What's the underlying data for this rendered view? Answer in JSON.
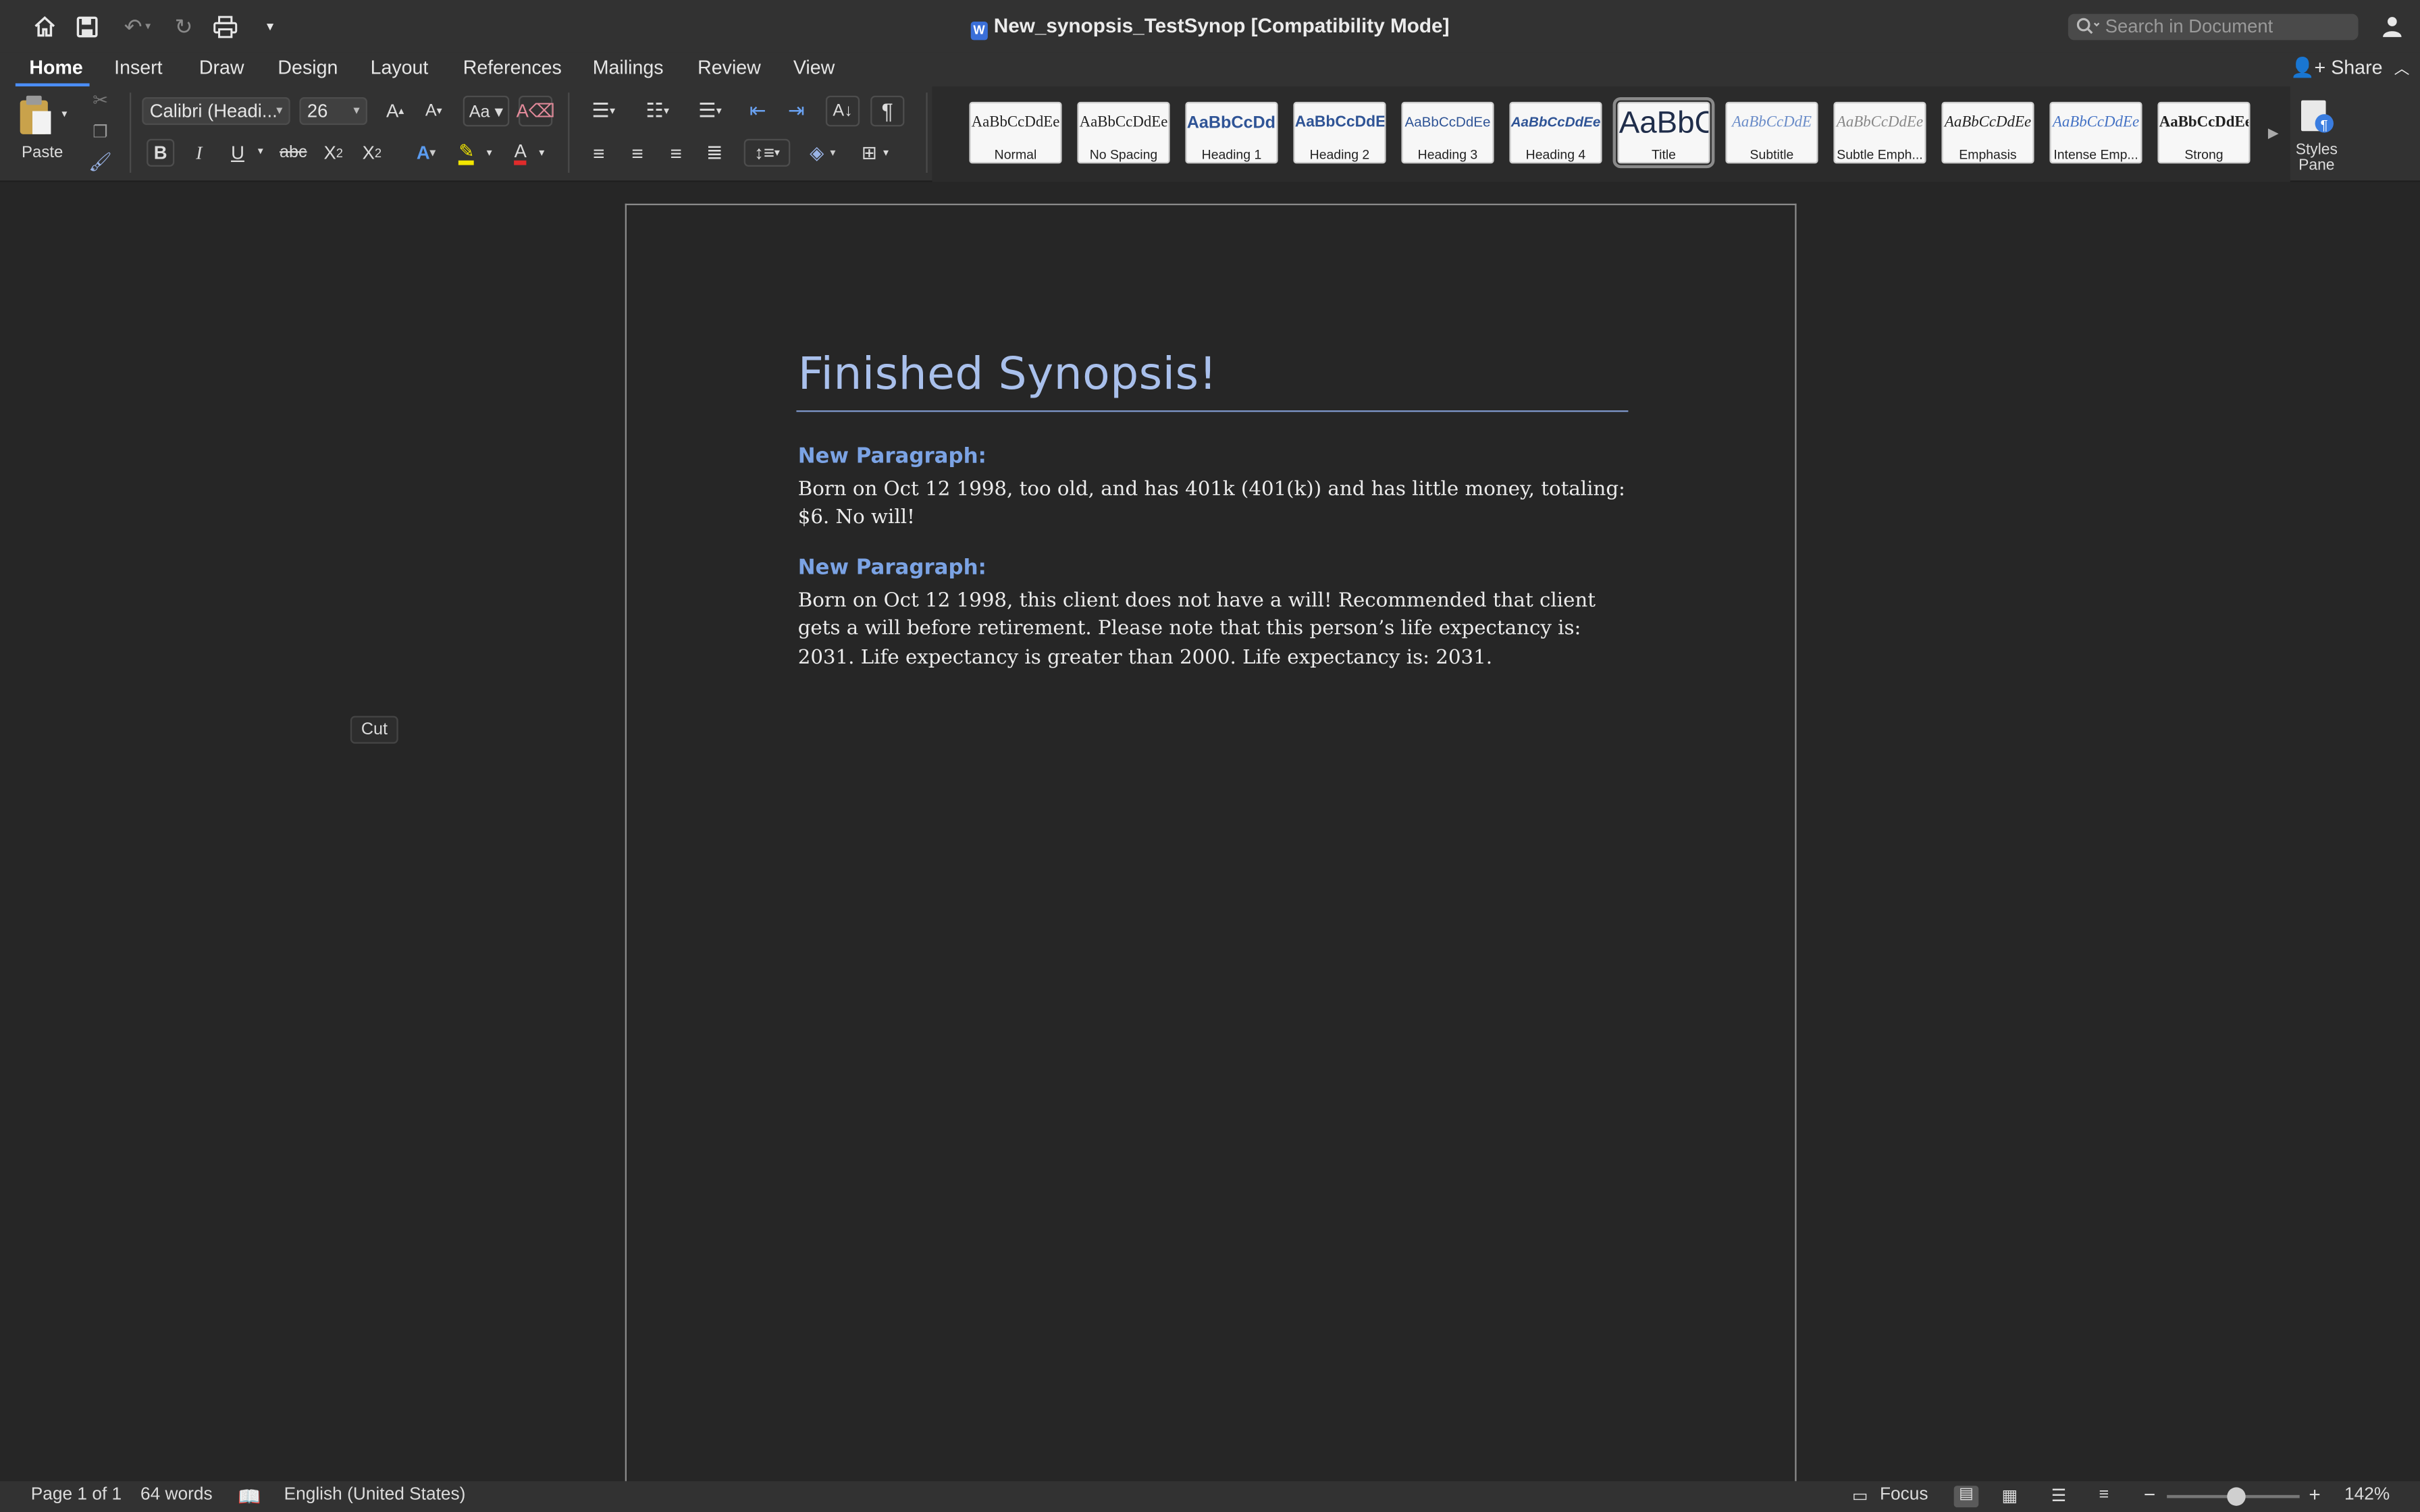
{
  "window": {
    "title": "New_synopsis_TestSynop [Compatibility Mode]",
    "search_placeholder": "Search in Document"
  },
  "tabs": [
    "Home",
    "Insert",
    "Draw",
    "Design",
    "Layout",
    "References",
    "Mailings",
    "Review",
    "View"
  ],
  "active_tab": "Home",
  "share_label": "Share",
  "ribbon": {
    "paste_label": "Paste",
    "font_name": "Calibri (Headi...",
    "font_size": "26",
    "styles": [
      {
        "sample": "AaBbCcDdEe",
        "name": "Normal"
      },
      {
        "sample": "AaBbCcDdEe",
        "name": "No Spacing"
      },
      {
        "sample": "AaBbCcDdI",
        "name": "Heading 1"
      },
      {
        "sample": "AaBbCcDdEe",
        "name": "Heading 2"
      },
      {
        "sample": "AaBbCcDdEe",
        "name": "Heading 3"
      },
      {
        "sample": "AaBbCcDdEe",
        "name": "Heading 4"
      },
      {
        "sample": "AaBbC",
        "name": "Title"
      },
      {
        "sample": "AaBbCcDdE",
        "name": "Subtitle"
      },
      {
        "sample": "AaBbCcDdEe",
        "name": "Subtle Emph..."
      },
      {
        "sample": "AaBbCcDdEe",
        "name": "Emphasis"
      },
      {
        "sample": "AaBbCcDdEe",
        "name": "Intense Emp..."
      },
      {
        "sample": "AaBbCcDdEe",
        "name": "Strong"
      }
    ],
    "selected_style": "Title",
    "styles_pane_label_1": "Styles",
    "styles_pane_label_2": "Pane"
  },
  "document": {
    "title": "Finished Synopsis!",
    "heading_1": "New Paragraph:",
    "paragraph_1": "Born on Oct 12 1998, too old, and has 401k (401(k)) and has little money, totaling: $6. No will!",
    "heading_2": "New Paragraph:",
    "paragraph_2": "Born on Oct 12 1998, this client does not have a will! Recommended that client gets a will before retirement. Please note that this person’s life expectancy is: 2031. Life expectancy is greater than 2000. Life expectancy is: 2031."
  },
  "tooltip": "Cut",
  "status": {
    "page": "Page 1 of 1",
    "words": "64 words",
    "language": "English (United States)",
    "focus": "Focus",
    "zoom": "142%",
    "zoom_level_fraction": 0.45
  },
  "colors": {
    "accent": "#4b8ef7",
    "doc_title": "#a9c0ec",
    "doc_heading": "#7ba3e4"
  }
}
